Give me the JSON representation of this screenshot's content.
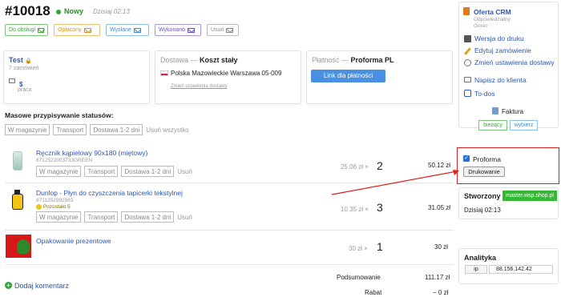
{
  "order": {
    "number": "#10018",
    "status": "Nowy",
    "date": "Dzisiaj 02:13"
  },
  "status_buttons": [
    {
      "label": "Do obsługi",
      "color": "#3aa63a"
    },
    {
      "label": "Opłacony",
      "color": "#e0a020"
    },
    {
      "label": "Wysłane",
      "color": "#3a8fd0"
    },
    {
      "label": "Wykonano",
      "color": "#6a4fc0"
    },
    {
      "label": "Usuń",
      "color": "#888888"
    }
  ],
  "customer": {
    "name": "Test",
    "orders": "7 zamówień",
    "contact_link": "$",
    "note": "praca"
  },
  "delivery": {
    "title_prefix": "Dostawa — ",
    "title": "Koszt stały",
    "address": "Polska Mazowieckie Warszawa 05-009",
    "change_link": "Zmień ustawienia dostawy"
  },
  "payment": {
    "title_prefix": "Płatność — ",
    "title": "Proforma PL",
    "link_button": "Link dla płatności"
  },
  "mass_status": {
    "label": "Masowe przypisywanie statusów:",
    "tags": [
      "W magazynie",
      "Transport",
      "Dostawa 1-2 dni"
    ],
    "remove_all": "Usuń wszystko"
  },
  "items": [
    {
      "name": "Ręcznik kąpielowy 90x180 (miętowy)",
      "sku": "8712522003733GREEN",
      "stock": "",
      "tags": [
        "W magazynie",
        "Transport",
        "Dostawa 1-2 dni"
      ],
      "remove": "Usuń",
      "unit_price": "25.06 zł ×",
      "qty": "2",
      "total": "50.12 zł"
    },
    {
      "name": "Dunlop - Płyn do czyszczenia tapicerki tekstylnej",
      "sku": "8711252992983",
      "stock": "Pozostało 5",
      "tags": [
        "W magazynie",
        "Transport",
        "Dostawa 1-2 dni"
      ],
      "remove": "Usuń",
      "unit_price": "10.35 zł ×",
      "qty": "3",
      "total": "31.05 zł"
    },
    {
      "name": "Opakowanie prezentowe",
      "sku": "",
      "stock": "",
      "tags": [],
      "remove": "",
      "unit_price": "30 zł ×",
      "qty": "1",
      "total": "30 zł"
    }
  ],
  "summary": {
    "add_comment": "Dodaj komentarz",
    "subtotal_label": "Podsumowanie",
    "subtotal": "111.17 zł",
    "discount_label": "Rabat",
    "discount": "− 0 zł"
  },
  "sidebar": {
    "crm_title": "Oferta CRM",
    "responsible_label": "Odpowiedzialny:",
    "responsible": "Gorec",
    "links": [
      "Wersja do druku",
      "Edytuj zamówienie",
      "Zmień ustawienia dostawy",
      "Napisz do klienta",
      "To-dos"
    ],
    "invoice_title": "Faktura",
    "invoice_current": "bieżący",
    "invoice_choose": "wybierz",
    "proforma_label": "Proforma",
    "print_button": "Drukowanie",
    "created_title": "Stworzony",
    "created_source": "master.wsp.shop.pl",
    "created_date": "Dzisiaj 02:13",
    "analytics_title": "Analityka",
    "ip_label": "ip",
    "ip_value": "88.156.142.42"
  },
  "colors": {
    "accent_blue": "#2a57b8",
    "button_blue": "#4a90e2",
    "status_green": "#2ea82e",
    "highlight_red": "#e02020",
    "source_badge_green": "#35b835"
  }
}
